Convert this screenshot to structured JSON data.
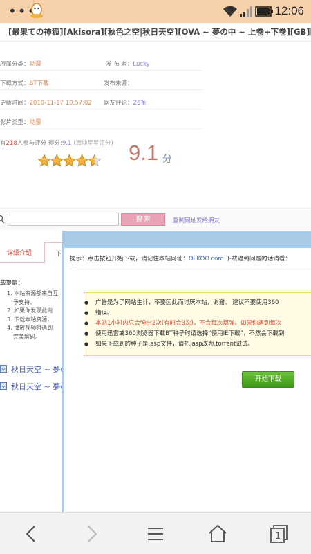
{
  "status": {
    "time": "12:06"
  },
  "page_title": "[最果ての神狐][Akisora][秋色之空|秋日天空][OVA ~ 夢の中 ~ 上卷+下卷][GB][RMVB]",
  "info": [
    {
      "label": "所属分类：",
      "value": "动漫"
    },
    {
      "label": "发 布 者：",
      "value": "Lucky"
    },
    {
      "label": "下载方式：",
      "value": "BT下载"
    },
    {
      "label": "发布来源：",
      "value": ""
    },
    {
      "label": "更新时间：",
      "value": "2010-11-17 10:57:02"
    },
    {
      "label": "网友评论：",
      "value": "26条"
    },
    {
      "label": "影片类型：",
      "value": "动漫"
    }
  ],
  "rating": {
    "prefix": "有",
    "count": "218",
    "mid": "人参与评分 得分:",
    "score_inline": "9.1",
    "hint": "(滑动星星评分)",
    "score_big": "9.1",
    "unit": "分",
    "stars": 4.5
  },
  "search": {
    "button_label": "搜 索",
    "share_link": "复制网址发给朋友"
  },
  "tabs": [
    {
      "label": "详细介绍"
    },
    {
      "label": "下"
    }
  ],
  "left_notes": {
    "heading": "载提醒：",
    "items": [
      "1. 本站资源都来自互",
      "予支持。",
      "2. 如果你发现此内",
      "3. 下载本站资源，",
      "4. 播放视频时遇到",
      "完美解码。"
    ]
  },
  "left_links": [
    "秋日天空 ~ 夢の",
    "秋日天空 ~ 夢の"
  ],
  "dialog": {
    "hint_prefix": "提示：点击按钮开始下载，请记住本站网址：",
    "hint_site": "DLKOO.com",
    "hint_suffix": " 下载遇到问题的话请看：",
    "notices": [
      "广告是为了网站生计，不要因此而讨厌本站，谢谢。 建议不要使用360",
      "错误。",
      "本站1小时内只会弹出2次(有时会3次)，不会每次都弹。如果你遇到每次",
      "使用迅雷或360浏览器下载BT种子时请选择“使用IE下载”，不然会下载到",
      "如果下载到的种子是.asp文件，请把.asp改为.torrent试试。"
    ],
    "download_button": "开始下载"
  },
  "colors": {
    "status_bar": "#f7d1aa",
    "dialog_header": "#a9cbe8",
    "accent_green": "#4aaa1c",
    "search_button": "#e8a3b6"
  }
}
